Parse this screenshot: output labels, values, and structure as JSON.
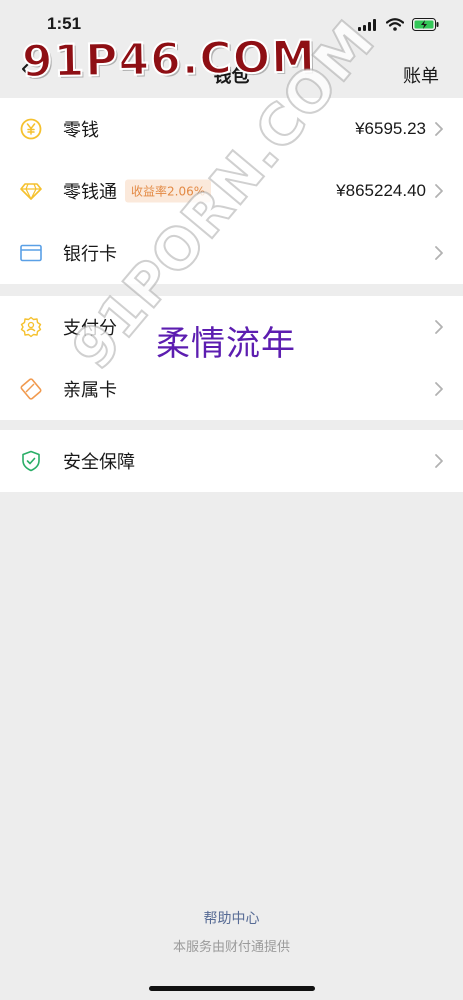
{
  "status_bar": {
    "time": "1:51"
  },
  "nav": {
    "title": "钱包",
    "action": "账单"
  },
  "groups": [
    {
      "items": [
        {
          "key": "change",
          "label": "零钱",
          "value": "¥6595.23",
          "icon": "yuan-circle-icon"
        },
        {
          "key": "wealth",
          "label": "零钱通",
          "badge": "收益率2.06%",
          "value": "¥865224.40",
          "icon": "diamond-icon"
        },
        {
          "key": "bank_card",
          "label": "银行卡",
          "icon": "bank-card-icon"
        }
      ]
    },
    {
      "items": [
        {
          "key": "pay_score",
          "label": "支付分",
          "icon": "pay-score-icon"
        },
        {
          "key": "family_card",
          "label": "亲属卡",
          "icon": "family-card-icon"
        }
      ]
    },
    {
      "items": [
        {
          "key": "security",
          "label": "安全保障",
          "icon": "shield-icon"
        }
      ]
    }
  ],
  "footer": {
    "help": "帮助中心",
    "provider": "本服务由财付通提供"
  },
  "overlays": {
    "caption": "柔情流年",
    "watermark_top": "91P46.COM",
    "watermark_diagonal": "91PORN.COM"
  },
  "colors": {
    "background": "#ededed",
    "link": "#576b95",
    "badge_text": "#e38a45",
    "badge_bg": "#fbe9db",
    "icon_yellow": "#f5c12e",
    "icon_blue": "#5aa0e6",
    "icon_orange": "#f19a4f",
    "icon_green": "#2aae67",
    "caption": "#5c1db0"
  }
}
